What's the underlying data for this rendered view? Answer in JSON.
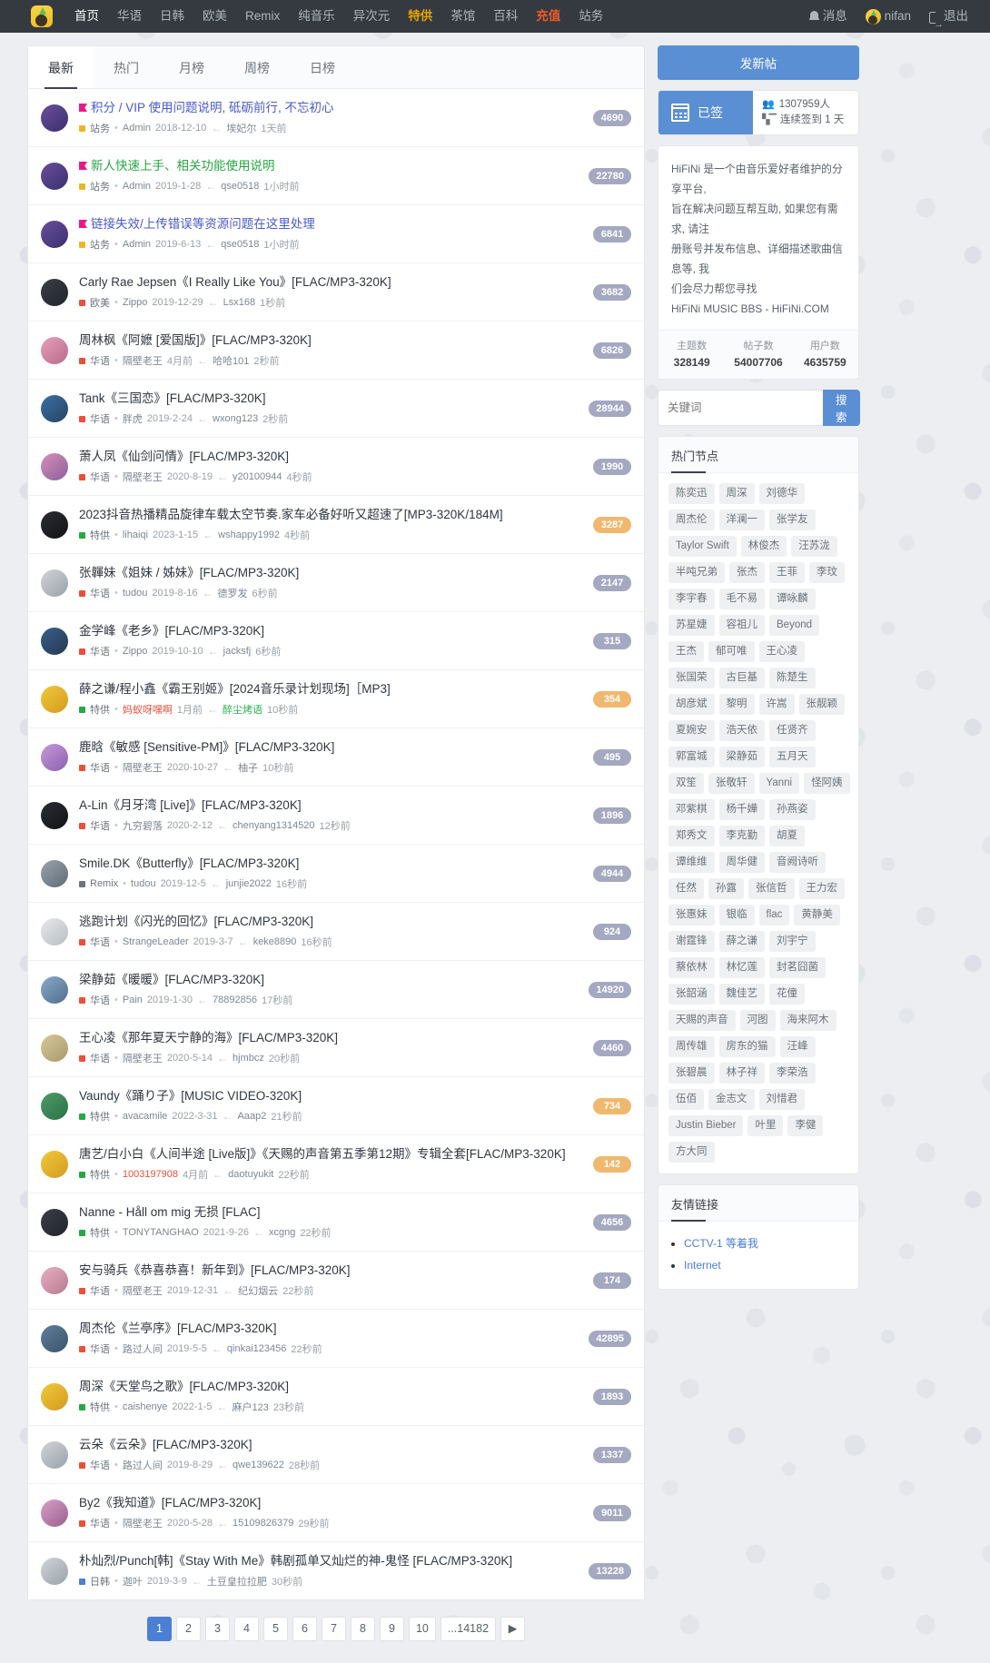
{
  "navbar": {
    "logo_icon": "site-logo-icon",
    "links": [
      {
        "label": "首页",
        "style": "active"
      },
      {
        "label": "华语",
        "style": ""
      },
      {
        "label": "日韩",
        "style": ""
      },
      {
        "label": "欧美",
        "style": ""
      },
      {
        "label": "Remix",
        "style": ""
      },
      {
        "label": "纯音乐",
        "style": ""
      },
      {
        "label": "异次元",
        "style": ""
      },
      {
        "label": "特供",
        "style": "gold"
      },
      {
        "label": "茶馆",
        "style": ""
      },
      {
        "label": "百科",
        "style": ""
      },
      {
        "label": "充值",
        "style": "red"
      },
      {
        "label": "站务",
        "style": ""
      }
    ],
    "messages_label": "消息",
    "username": "nifan",
    "logout_label": "退出"
  },
  "tabs": [
    {
      "label": "最新",
      "active": true
    },
    {
      "label": "热门",
      "active": false
    },
    {
      "label": "月榜",
      "active": false
    },
    {
      "label": "周榜",
      "active": false
    },
    {
      "label": "日榜",
      "active": false
    }
  ],
  "threads": [
    {
      "title": "积分 / VIP 使用问题说明, 砥砺前行, 不忘初心",
      "flag": true,
      "title_color": "#4a5acb",
      "cat": "站务",
      "cat_color": "#e8b62c",
      "author": "Admin",
      "date": "2018-12-10",
      "replier": "埃妃尔",
      "ago": "1天前",
      "count": "4690",
      "count_style": ""
    },
    {
      "title": "新人快速上手、相关功能使用说明",
      "flag": true,
      "title_color": "#28a745",
      "cat": "站务",
      "cat_color": "#e8b62c",
      "author": "Admin",
      "date": "2019-1-28",
      "replier": "qse0518",
      "ago": "1小时前",
      "count": "22780",
      "count_style": ""
    },
    {
      "title": "链接失效/上传错误等资源问题在这里处理",
      "flag": true,
      "title_color": "#4a5acb",
      "cat": "站务",
      "cat_color": "#e8b62c",
      "author": "Admin",
      "date": "2019-6-13",
      "replier": "qse0518",
      "ago": "1小时前",
      "count": "6841",
      "count_style": ""
    },
    {
      "title": "Carly Rae Jepsen《I Really Like You》[FLAC/MP3-320K]",
      "flag": false,
      "title_color": "#2f3640",
      "cat": "欧美",
      "cat_color": "#e8503a",
      "author": "Zippo",
      "date": "2019-12-29",
      "replier": "Lsx168",
      "ago": "1秒前",
      "count": "3682",
      "count_style": ""
    },
    {
      "title": "周林枫《阿嬷 [爱国版]》[FLAC/MP3-320K]",
      "flag": false,
      "title_color": "#2f3640",
      "cat": "华语",
      "cat_color": "#e8503a",
      "author": "隔壁老王",
      "date": "4月前",
      "replier": "哈哈101",
      "ago": "2秒前",
      "count": "6826",
      "count_style": ""
    },
    {
      "title": "Tank《三国恋》[FLAC/MP3-320K]",
      "flag": false,
      "title_color": "#2f3640",
      "cat": "华语",
      "cat_color": "#e8503a",
      "author": "胖虎",
      "date": "2019-2-24",
      "replier": "wxong123",
      "ago": "2秒前",
      "count": "28944",
      "count_style": ""
    },
    {
      "title": "萧人凤《仙剑问情》[FLAC/MP3-320K]",
      "flag": false,
      "title_color": "#2f3640",
      "cat": "华语",
      "cat_color": "#e8503a",
      "author": "隔壁老王",
      "date": "2020-8-19",
      "replier": "y20100944",
      "ago": "4秒前",
      "count": "1990",
      "count_style": ""
    },
    {
      "title": "2023抖音热播精品旋律车载太空节奏.家车必备好听又超速了[MP3-320K/184M]",
      "flag": false,
      "title_color": "#2f3640",
      "cat": "特供",
      "cat_color": "#28a745",
      "author": "lihaiqi",
      "date": "2023-1-15",
      "replier": "wshappy1992",
      "ago": "4秒前",
      "count": "3287",
      "count_style": "orange"
    },
    {
      "title": "张韗妹《姐妹 / 姊妹》[FLAC/MP3-320K]",
      "flag": false,
      "title_color": "#2f3640",
      "cat": "华语",
      "cat_color": "#e8503a",
      "author": "tudou",
      "date": "2019-8-16",
      "replier": "德罗发",
      "ago": "6秒前",
      "count": "2147",
      "count_style": ""
    },
    {
      "title": "金学峰《老乡》[FLAC/MP3-320K]",
      "flag": false,
      "title_color": "#2f3640",
      "cat": "华语",
      "cat_color": "#e8503a",
      "author": "Zippo",
      "date": "2019-10-10",
      "replier": "jacksfj",
      "ago": "6秒前",
      "count": "315",
      "count_style": ""
    },
    {
      "title": "薛之谦/程小鑫《霸王别姬》[2024音乐录计划现场]［MP3]",
      "flag": false,
      "title_color": "#2f3640",
      "cat": "特供",
      "cat_color": "#28a745",
      "author": "妈蚁呀嘿啊",
      "date": "1月前",
      "replier": "醉尘烤语",
      "ago": "10秒前",
      "count": "354",
      "count_style": "orange",
      "author_color": "red",
      "replier_color": "green"
    },
    {
      "title": "鹿晗《敏感 [Sensitive-PM]》[FLAC/MP3-320K]",
      "flag": false,
      "title_color": "#2f3640",
      "cat": "华语",
      "cat_color": "#e8503a",
      "author": "隔壁老王",
      "date": "2020-10-27",
      "replier": "柚子",
      "ago": "10秒前",
      "count": "495",
      "count_style": ""
    },
    {
      "title": "A-Lin《月牙湾 [Live]》[FLAC/MP3-320K]",
      "flag": false,
      "title_color": "#2f3640",
      "cat": "华语",
      "cat_color": "#e8503a",
      "author": "九穷碧落",
      "date": "2020-2-12",
      "replier": "chenyang1314520",
      "ago": "12秒前",
      "count": "1896",
      "count_style": ""
    },
    {
      "title": "Smile.DK《Butterfly》[FLAC/MP3-320K]",
      "flag": false,
      "title_color": "#2f3640",
      "cat": "Remix",
      "cat_color": "#6c757d",
      "author": "tudou",
      "date": "2019-12-5",
      "replier": "junjie2022",
      "ago": "16秒前",
      "count": "4944",
      "count_style": ""
    },
    {
      "title": "逃跑计划《闪光的回忆》[FLAC/MP3-320K]",
      "flag": false,
      "title_color": "#2f3640",
      "cat": "华语",
      "cat_color": "#e8503a",
      "author": "StrangeLeader",
      "date": "2019-3-7",
      "replier": "keke8890",
      "ago": "16秒前",
      "count": "924",
      "count_style": ""
    },
    {
      "title": "梁静茹《暖暖》[FLAC/MP3-320K]",
      "flag": false,
      "title_color": "#2f3640",
      "cat": "华语",
      "cat_color": "#e8503a",
      "author": "Pain",
      "date": "2019-1-30",
      "replier": "78892856",
      "ago": "17秒前",
      "count": "14920",
      "count_style": ""
    },
    {
      "title": "王心凌《那年夏天宁静的海》[FLAC/MP3-320K]",
      "flag": false,
      "title_color": "#2f3640",
      "cat": "华语",
      "cat_color": "#e8503a",
      "author": "隔壁老王",
      "date": "2020-5-14",
      "replier": "hjmbcz",
      "ago": "20秒前",
      "count": "4460",
      "count_style": ""
    },
    {
      "title": "Vaundy《踊り子》[MUSIC VIDEO-320K]",
      "flag": false,
      "title_color": "#2f3640",
      "cat": "特供",
      "cat_color": "#28a745",
      "author": "avacamile",
      "date": "2022-3-31",
      "replier": "Aaap2",
      "ago": "21秒前",
      "count": "734",
      "count_style": "orange"
    },
    {
      "title": "唐艺/白小白《人间半途 [Live版]》《天赐的声音第五季第12期》专辑全套[FLAC/MP3-320K]",
      "flag": false,
      "title_color": "#2f3640",
      "cat": "特供",
      "cat_color": "#28a745",
      "author": "1003197908",
      "date": "4月前",
      "replier": "daotuyukit",
      "ago": "22秒前",
      "count": "142",
      "count_style": "orange",
      "author_color": "red"
    },
    {
      "title": "Nanne - Håll om mig 无损 [FLAC]",
      "flag": false,
      "title_color": "#2f3640",
      "cat": "特供",
      "cat_color": "#28a745",
      "author": "TONYTANGHAO",
      "date": "2021-9-26",
      "replier": "xcgng",
      "ago": "22秒前",
      "count": "4656",
      "count_style": ""
    },
    {
      "title": "安与骑兵《恭喜恭喜！新年到》[FLAC/MP3-320K]",
      "flag": false,
      "title_color": "#2f3640",
      "cat": "华语",
      "cat_color": "#e8503a",
      "author": "隔壁老王",
      "date": "2019-12-31",
      "replier": "纪幻烟云",
      "ago": "22秒前",
      "count": "174",
      "count_style": ""
    },
    {
      "title": "周杰伦《兰亭序》[FLAC/MP3-320K]",
      "flag": false,
      "title_color": "#2f3640",
      "cat": "华语",
      "cat_color": "#e8503a",
      "author": "路过人间",
      "date": "2019-5-5",
      "replier": "qinkai123456",
      "ago": "22秒前",
      "count": "42895",
      "count_style": ""
    },
    {
      "title": "周深《天堂鸟之歌》[FLAC/MP3-320K]",
      "flag": false,
      "title_color": "#2f3640",
      "cat": "特供",
      "cat_color": "#28a745",
      "author": "caishenye",
      "date": "2022-1-5",
      "replier": "麻户123",
      "ago": "23秒前",
      "count": "1893",
      "count_style": ""
    },
    {
      "title": "云朵《云朵》[FLAC/MP3-320K]",
      "flag": false,
      "title_color": "#2f3640",
      "cat": "华语",
      "cat_color": "#e8503a",
      "author": "路过人间",
      "date": "2019-8-29",
      "replier": "qwe139622",
      "ago": "28秒前",
      "count": "1337",
      "count_style": ""
    },
    {
      "title": "By2《我知道》[FLAC/MP3-320K]",
      "flag": false,
      "title_color": "#2f3640",
      "cat": "华语",
      "cat_color": "#e8503a",
      "author": "隔壁老王",
      "date": "2020-5-28",
      "replier": "15109826379",
      "ago": "29秒前",
      "count": "9011",
      "count_style": ""
    },
    {
      "title": "朴灿烈/Punch[韩]《Stay With Me》韩剧孤单又灿烂的神-鬼怪 [FLAC/MP3-320K]",
      "flag": false,
      "title_color": "#2f3640",
      "cat": "日韩",
      "cat_color": "#4a7fd4",
      "author": "迦叶",
      "date": "2019-3-9",
      "replier": "土豆皇拉拉肥",
      "ago": "30秒前",
      "count": "13228",
      "count_style": ""
    }
  ],
  "pagination": {
    "pages": [
      "1",
      "2",
      "3",
      "4",
      "5",
      "6",
      "7",
      "8",
      "9",
      "10",
      "...14182"
    ],
    "active": "1",
    "next_label": "▶"
  },
  "sidebar": {
    "new_post_label": "发新帖",
    "sign_label": "已签",
    "sign_icon": "calendar-icon",
    "members_count": "1307959人",
    "streak_text": "连续签到 1 天",
    "about_lines": [
      "HiFiNi 是一个由音乐爱好者维护的分享平台,",
      "旨在解决问题互帮互助, 如果您有需求, 请注",
      "册账号并发布信息、详细描述歌曲信息等, 我",
      "们会尽力帮您寻找"
    ],
    "about_footer": "HiFiNi MUSIC BBS - HiFiNi.COM",
    "stats": [
      {
        "label": "主题数",
        "value": "328149"
      },
      {
        "label": "帖子数",
        "value": "54007706"
      },
      {
        "label": "用户数",
        "value": "4635759"
      }
    ],
    "search_placeholder": "关键词",
    "search_button": "搜索",
    "hot_nodes_title": "热门节点",
    "hot_nodes": [
      "陈奕迅",
      "周深",
      "刘德华",
      "周杰伦",
      "洋澜一",
      "张学友",
      "Taylor Swift",
      "林俊杰",
      "汪苏泷",
      "半吨兄弟",
      "张杰",
      "王菲",
      "李玟",
      "李宇春",
      "毛不易",
      "谭咏麟",
      "苏星婕",
      "容祖儿",
      "Beyond",
      "王杰",
      "郁可唯",
      "王心凌",
      "张国荣",
      "古巨基",
      "陈楚生",
      "胡彦斌",
      "黎明",
      "许嵩",
      "张靓颖",
      "夏婉安",
      "浩天依",
      "任贤齐",
      "郭富城",
      "梁静茹",
      "五月天",
      "双笙",
      "张敬轩",
      "Yanni",
      "怪阿姨",
      "邓紫棋",
      "杨千嬅",
      "孙燕姿",
      "郑秀文",
      "李克勤",
      "胡夏",
      "谭维维",
      "周华健",
      "音阙诗听",
      "任然",
      "孙露",
      "张信哲",
      "王力宏",
      "张惠妹",
      "银临",
      "flac",
      "黄静美",
      "谢霆锋",
      "薛之谦",
      "刘宇宁",
      "蔡依林",
      "林忆莲",
      "封茗囧菌",
      "张韶涵",
      "魏佳艺",
      "花僮",
      "天赐的声音",
      "河图",
      "海来阿木",
      "周传雄",
      "房东的猫",
      "汪峰",
      "张碧晨",
      "林子祥",
      "李荣浩",
      "伍佰",
      "金志文",
      "刘惜君",
      "Justin Bieber",
      "叶里",
      "李健",
      "方大同"
    ],
    "friend_links_title": "友情链接",
    "friend_links": [
      "CCTV-1 等着我",
      "Internet"
    ]
  }
}
